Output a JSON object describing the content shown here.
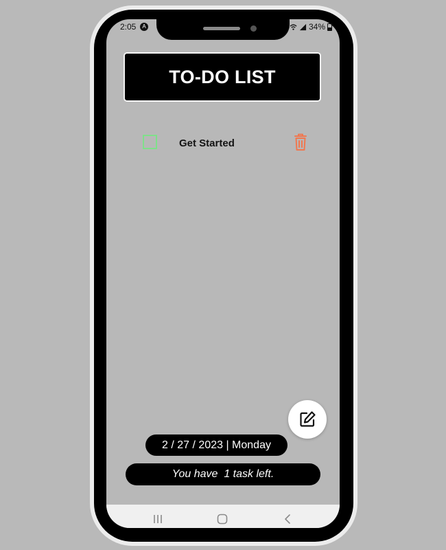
{
  "status_bar": {
    "time": "2:05",
    "battery": "34%"
  },
  "header": {
    "title": "TO-DO LIST"
  },
  "tasks": [
    {
      "label": "Get Started",
      "checked": false
    }
  ],
  "footer": {
    "date": "2 / 27 / 2023 | Monday",
    "tasks_left": "You have  1 task left."
  },
  "colors": {
    "background": "#b8b8b8",
    "checkbox_border": "#7fe08a",
    "trash": "#f07850",
    "pill": "#000000"
  },
  "icons": {
    "trash": "trash-icon",
    "edit": "edit-icon",
    "nav_recents": "recents-icon",
    "nav_home": "home-icon",
    "nav_back": "back-icon"
  }
}
